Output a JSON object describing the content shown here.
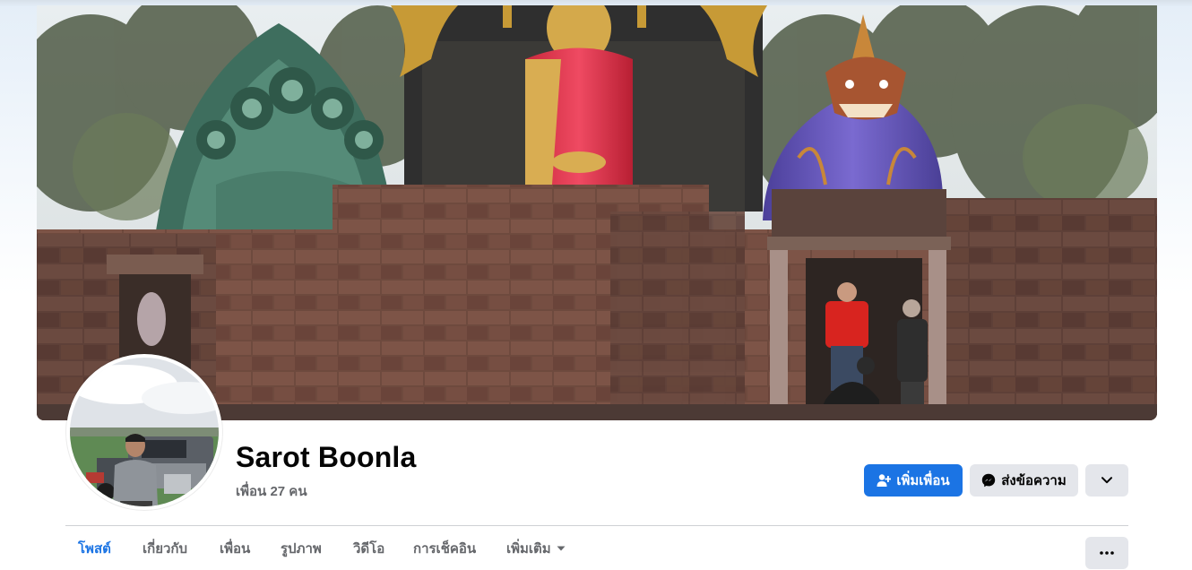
{
  "profile": {
    "name": "Sarot Boonla",
    "friends_text": "เพื่อน 27 คน"
  },
  "actions": {
    "add_friend_label": "เพิ่มเพื่อน",
    "message_label": "ส่งข้อความ",
    "add_friend_icon": "person-add-icon",
    "message_icon": "messenger-icon",
    "more_icon": "chevron-down-icon"
  },
  "tabs": [
    {
      "label": "โพสต์",
      "active": true
    },
    {
      "label": "เกี่ยวกับ",
      "active": false
    },
    {
      "label": "เพื่อน",
      "active": false
    },
    {
      "label": "รูปภาพ",
      "active": false
    },
    {
      "label": "วิดีโอ",
      "active": false
    },
    {
      "label": "การเช็คอิน",
      "active": false
    },
    {
      "label": "เพิ่มเติม",
      "active": false,
      "has_dropdown": true
    }
  ],
  "tab_more_icon": "ellipsis-icon",
  "colors": {
    "accent": "#1b74e4",
    "secondary_button": "#e4e6eb",
    "muted_text": "#65676b"
  }
}
